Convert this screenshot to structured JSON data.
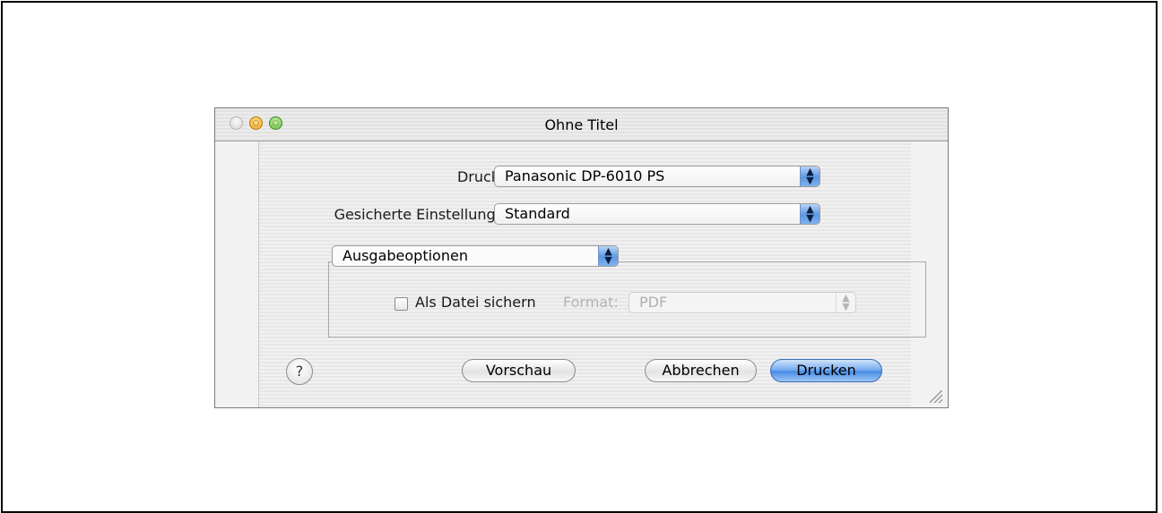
{
  "window": {
    "title": "Ohne Titel"
  },
  "printer": {
    "label": "Drucker:",
    "value": "Panasonic DP-6010 PS"
  },
  "presets": {
    "label": "Gesicherte Einstellungen:",
    "value": "Standard"
  },
  "panel": {
    "value": "Ausgabeoptionen"
  },
  "save_as_file": {
    "label": "Als Datei sichern",
    "checked": false
  },
  "format": {
    "label": "Format:",
    "value": "PDF",
    "enabled": false
  },
  "buttons": {
    "help": "?",
    "preview": "Vorschau",
    "cancel": "Abbrechen",
    "print": "Drucken"
  },
  "icons": {
    "popup_arrow": "⇕ up-down-arrows",
    "help": "question-mark",
    "resize": "resize-grip"
  },
  "colors": {
    "default_button": "#4a8be3",
    "popup_arrow": "#5d97e2",
    "minimize_light": "#f0a11a",
    "zoom_light": "#5fbc3e"
  }
}
